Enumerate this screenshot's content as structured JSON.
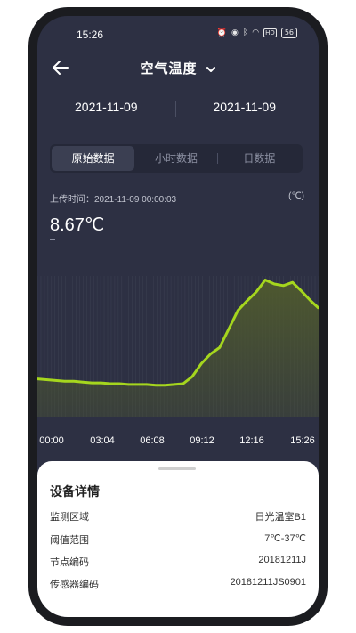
{
  "status_bar": {
    "time": "15:26",
    "icons": [
      "alarm-icon",
      "vibrate-icon",
      "bluetooth-icon",
      "wifi-icon",
      "hd-icon",
      "battery-icon"
    ],
    "battery": "56"
  },
  "header": {
    "title": "空气温度"
  },
  "dates": {
    "start": "2021-11-09",
    "end": "2021-11-09"
  },
  "tabs": [
    {
      "label": "原始数据",
      "active": true
    },
    {
      "label": "小时数据",
      "active": false
    },
    {
      "label": "日数据",
      "active": false
    }
  ],
  "reading": {
    "upload_label": "上传时间：",
    "upload_time": "2021-11-09 00:00:03",
    "unit": "(℃)",
    "value": "8.67℃"
  },
  "chart_data": {
    "type": "area",
    "x_ticks": [
      "00:00",
      "03:04",
      "06:08",
      "09:12",
      "12:16",
      "15:26"
    ],
    "x": [
      0,
      0.5,
      1,
      1.5,
      2,
      2.5,
      3,
      3.5,
      4,
      4.5,
      5,
      5.5,
      6,
      6.5,
      7,
      7.5,
      8,
      8.5,
      9,
      9.5,
      10,
      10.5,
      11,
      11.5,
      12,
      12.5,
      13,
      13.5,
      14,
      14.5,
      15,
      15.43
    ],
    "series": [
      {
        "values": [
          8.7,
          8.6,
          8.5,
          8.4,
          8.4,
          8.3,
          8.2,
          8.2,
          8.1,
          8.1,
          8.0,
          8.0,
          8.0,
          7.9,
          7.9,
          8.0,
          8.1,
          9.0,
          10.6,
          11.8,
          12.6,
          14.9,
          17.2,
          18.4,
          19.5,
          21.0,
          20.5,
          20.3,
          20.7,
          19.6,
          18.4,
          17.5
        ]
      }
    ],
    "colors": {
      "line": "#a5d61e",
      "fill": "#4f5a2e",
      "grid": "#3a3e50",
      "background": "#2d3043"
    }
  },
  "details": {
    "title": "设备详情",
    "rows": [
      {
        "label": "监测区域",
        "value": "日光温室B1"
      },
      {
        "label": "阈值范围",
        "value": "7℃-37℃"
      },
      {
        "label": "节点编码",
        "value": "20181211J"
      },
      {
        "label": "传感器编码",
        "value": "20181211JS0901"
      }
    ]
  }
}
